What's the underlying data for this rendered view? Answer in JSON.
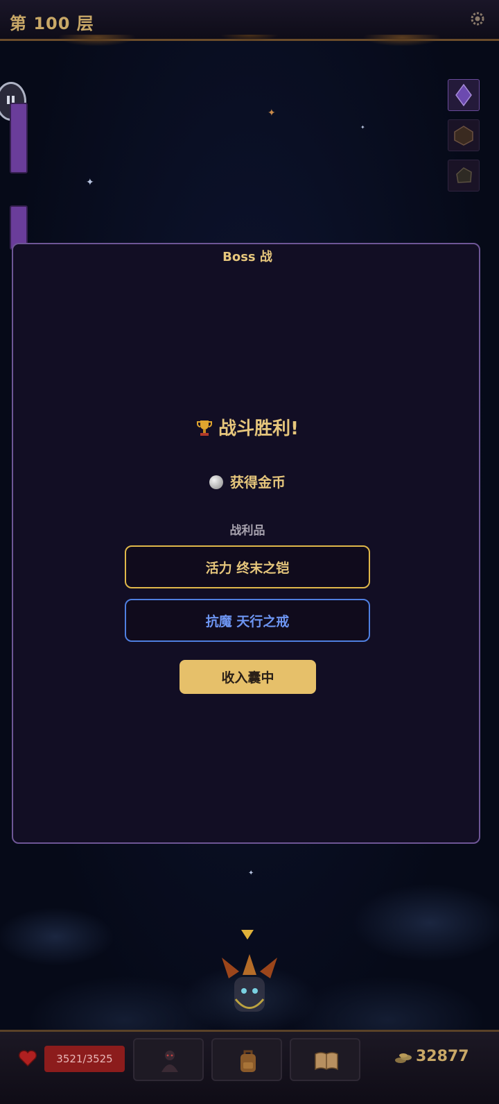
{
  "header": {
    "floor_title": "第 100 层"
  },
  "modal": {
    "title": "Boss 战",
    "victory_text": "战斗胜利!",
    "gold_text": "获得金币",
    "loot_label": "战利品",
    "loot_items": [
      {
        "label": "活力 终末之铠",
        "rarity_color": "#e0b84a"
      },
      {
        "label": "抗魔 天行之戒",
        "rarity_color": "#4f7fe0"
      }
    ],
    "collect_button": "收入囊中"
  },
  "footer": {
    "hp": "3521/3525",
    "gold": "32877",
    "nav": [
      "character-icon",
      "backpack-icon",
      "book-icon"
    ]
  },
  "colors": {
    "accent_gold": "#e6c67c",
    "modal_bg": "#120e24",
    "modal_border": "#6e5696",
    "hp_red": "#8c1c1c"
  }
}
